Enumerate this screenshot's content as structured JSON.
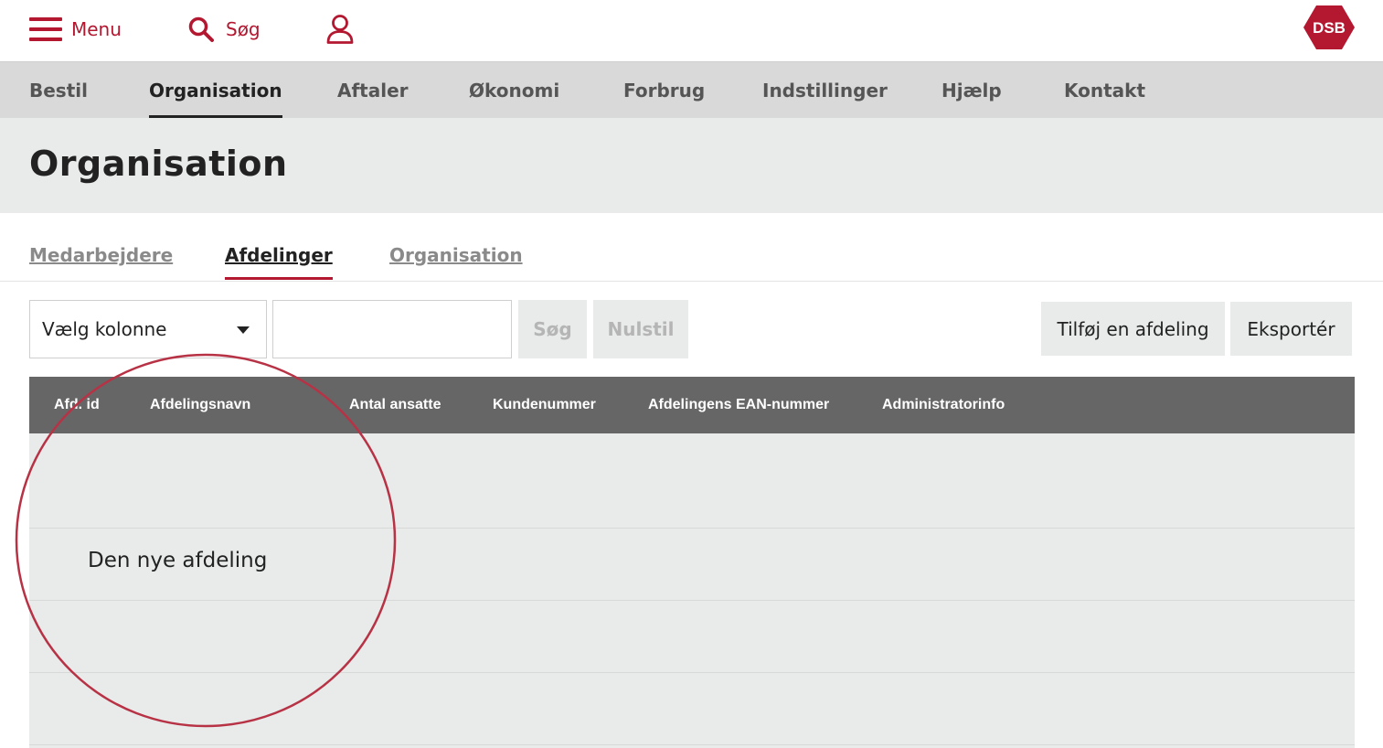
{
  "topbar": {
    "menu_label": "Menu",
    "search_label": "Søg",
    "logo_text": "DSB",
    "brand_color": "#b41730"
  },
  "mainnav": {
    "items": [
      {
        "label": "Bestil"
      },
      {
        "label": "Organisation",
        "active": true
      },
      {
        "label": "Aftaler"
      },
      {
        "label": "Økonomi"
      },
      {
        "label": "Forbrug"
      },
      {
        "label": "Indstillinger"
      },
      {
        "label": "Hjælp"
      },
      {
        "label": "Kontakt"
      }
    ]
  },
  "page": {
    "title": "Organisation"
  },
  "subtabs": {
    "items": [
      {
        "label": "Medarbejdere"
      },
      {
        "label": "Afdelinger",
        "active": true
      },
      {
        "label": "Organisation"
      }
    ]
  },
  "filters": {
    "column_select_value": "Vælg kolonne",
    "search_input_value": "",
    "search_button": "Søg",
    "reset_button": "Nulstil",
    "add_department_button": "Tilføj en afdeling",
    "export_button": "Eksportér"
  },
  "table": {
    "columns": [
      "Afd. id",
      "Afdelingsnavn",
      "Antal ansatte",
      "Kundenummer",
      "Afdelingens EAN-nummer",
      "Administratorinfo"
    ],
    "rows": [
      {
        "name": ""
      },
      {
        "name": "Den nye afdeling"
      },
      {
        "name": ""
      },
      {
        "name": ""
      }
    ]
  },
  "annotation": {
    "color": "#b83245"
  }
}
